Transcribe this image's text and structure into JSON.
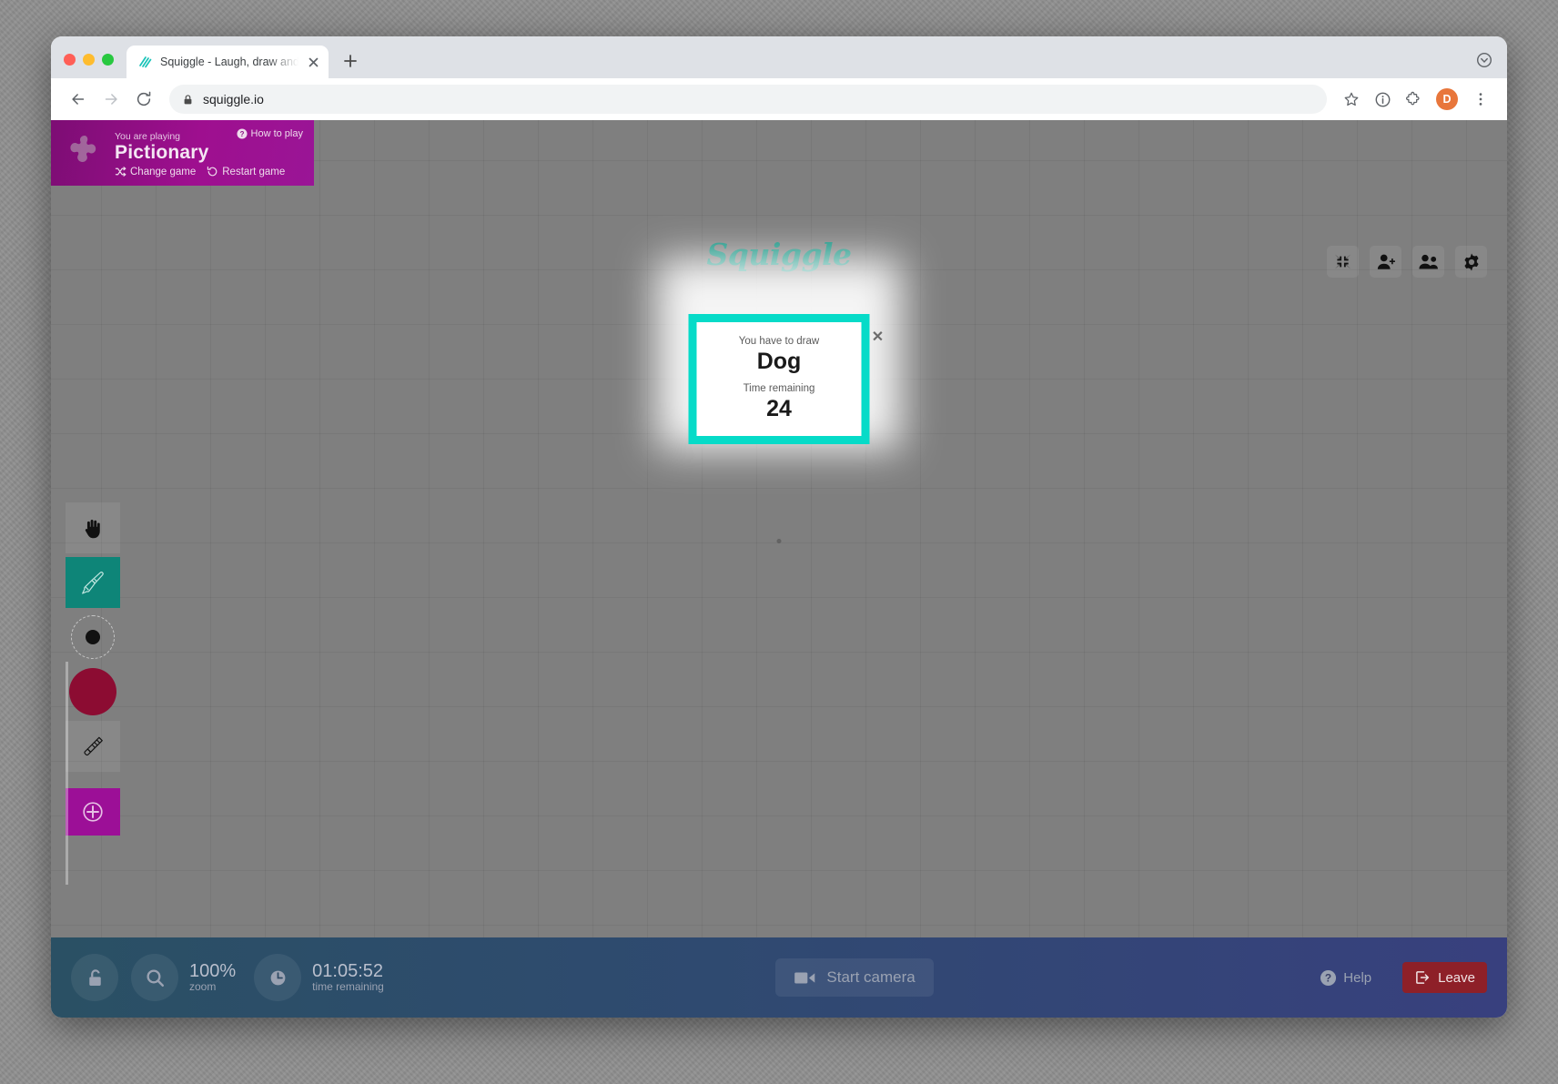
{
  "browser": {
    "tab": {
      "title": "Squiggle - Laugh, draw and play",
      "favicon": "squiggle-favicon-icon",
      "close": "×"
    },
    "new_tab_label": "+",
    "url": "squiggle.io",
    "nav": {
      "back": "back-icon",
      "forward": "forward-icon",
      "reload": "reload-icon",
      "lock": "lock-icon"
    },
    "omni": {
      "bookmark": "star-icon",
      "info": "info-icon",
      "extensions": "puzzle-extension-icon",
      "menu": "kebab-menu-icon"
    },
    "profile_initial": "D"
  },
  "banner": {
    "eyebrow": "You are playing",
    "game": "Pictionary",
    "how_to_play": "How to play",
    "change_game": "Change game",
    "restart_game": "Restart game"
  },
  "logo": {
    "text": "Squiggle",
    "color": "#13907f"
  },
  "topbar_icons": [
    {
      "name": "collapse-icon",
      "label": "Collapse"
    },
    {
      "name": "add-person-icon",
      "label": "Invite"
    },
    {
      "name": "people-icon",
      "label": "Players"
    },
    {
      "name": "gear-icon",
      "label": "Settings"
    }
  ],
  "tools": [
    {
      "name": "hand-tool",
      "label": "Hand",
      "active": false
    },
    {
      "name": "brush-tool",
      "label": "Brush",
      "active": true
    },
    {
      "name": "brush-size-tool",
      "label": "Brush size",
      "active": false
    },
    {
      "name": "color-swatch-tool",
      "label": "Color",
      "color": "#8c0c32",
      "active": false
    },
    {
      "name": "eraser-tool",
      "label": "Eraser",
      "active": false
    },
    {
      "name": "add-tool",
      "label": "Add",
      "active": false
    }
  ],
  "modal": {
    "prompt_label": "You have to draw",
    "word": "Dog",
    "time_label": "Time remaining",
    "time_value": "24",
    "close": "✕",
    "accent": "#06dbc8"
  },
  "bottombar": {
    "lock": "unlock-icon",
    "zoom_value": "100%",
    "zoom_label": "zoom",
    "clock": "clock-icon",
    "time_value": "01:05:52",
    "time_label": "time remaining",
    "camera_label": "Start camera",
    "help_label": "Help",
    "leave_label": "Leave"
  }
}
